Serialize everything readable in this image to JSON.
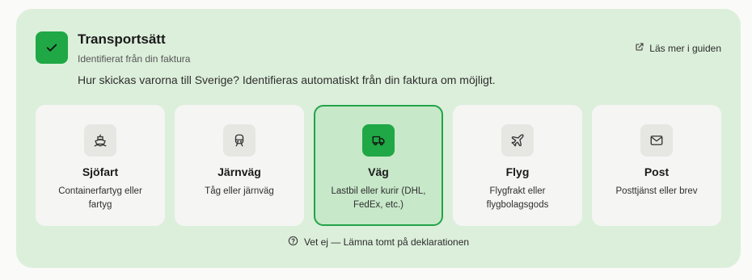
{
  "header": {
    "title": "Transportsätt",
    "subtitle": "Identifierat från din faktura",
    "guide_link": "Läs mer i guiden",
    "question": "Hur skickas varorna till Sverige? Identifieras automatiskt från din faktura om möjligt."
  },
  "options": [
    {
      "name": "Sjöfart",
      "desc": "Containerfartyg eller fartyg",
      "icon": "ship-icon"
    },
    {
      "name": "Järnväg",
      "desc": "Tåg eller järnväg",
      "icon": "train-icon"
    },
    {
      "name": "Väg",
      "desc": "Lastbil eller kurir (DHL, FedEx, etc.)",
      "icon": "truck-icon",
      "selected": true
    },
    {
      "name": "Flyg",
      "desc": "Flygfrakt eller flygbolagsgods",
      "icon": "plane-icon"
    },
    {
      "name": "Post",
      "desc": "Posttjänst eller brev",
      "icon": "mail-icon"
    }
  ],
  "unknown_option": "Vet ej — Lämna tomt på deklarationen",
  "colors": {
    "accent": "#1fa845",
    "panel_bg": "#dcefdb",
    "selected_bg": "#c7e8c9"
  }
}
